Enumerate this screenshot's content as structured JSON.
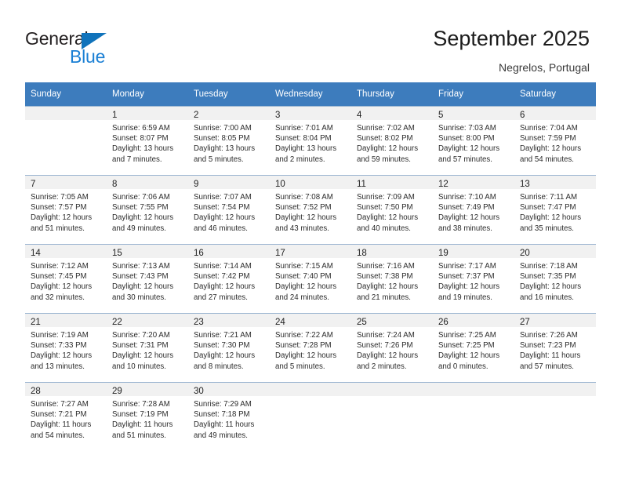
{
  "brand": {
    "name_top": "General",
    "name_bottom": "Blue",
    "triangle_color": "#1073bb",
    "blue_text_color": "#1a7fd4"
  },
  "header": {
    "title": "September 2025",
    "location": "Negrelos, Portugal"
  },
  "theme": {
    "header_blue": "#3d7cbd",
    "day_band_gray": "#f1f1f1",
    "row_line": "#9ab4d0"
  },
  "calendar": {
    "weekday_headers": [
      "Sunday",
      "Monday",
      "Tuesday",
      "Wednesday",
      "Thursday",
      "Friday",
      "Saturday"
    ],
    "weeks": [
      [
        {
          "day": "",
          "sunrise": "",
          "sunset": "",
          "daylight_line1": "",
          "daylight_line2": ""
        },
        {
          "day": "1",
          "sunrise": "Sunrise: 6:59 AM",
          "sunset": "Sunset: 8:07 PM",
          "daylight_line1": "Daylight: 13 hours",
          "daylight_line2": "and 7 minutes."
        },
        {
          "day": "2",
          "sunrise": "Sunrise: 7:00 AM",
          "sunset": "Sunset: 8:05 PM",
          "daylight_line1": "Daylight: 13 hours",
          "daylight_line2": "and 5 minutes."
        },
        {
          "day": "3",
          "sunrise": "Sunrise: 7:01 AM",
          "sunset": "Sunset: 8:04 PM",
          "daylight_line1": "Daylight: 13 hours",
          "daylight_line2": "and 2 minutes."
        },
        {
          "day": "4",
          "sunrise": "Sunrise: 7:02 AM",
          "sunset": "Sunset: 8:02 PM",
          "daylight_line1": "Daylight: 12 hours",
          "daylight_line2": "and 59 minutes."
        },
        {
          "day": "5",
          "sunrise": "Sunrise: 7:03 AM",
          "sunset": "Sunset: 8:00 PM",
          "daylight_line1": "Daylight: 12 hours",
          "daylight_line2": "and 57 minutes."
        },
        {
          "day": "6",
          "sunrise": "Sunrise: 7:04 AM",
          "sunset": "Sunset: 7:59 PM",
          "daylight_line1": "Daylight: 12 hours",
          "daylight_line2": "and 54 minutes."
        }
      ],
      [
        {
          "day": "7",
          "sunrise": "Sunrise: 7:05 AM",
          "sunset": "Sunset: 7:57 PM",
          "daylight_line1": "Daylight: 12 hours",
          "daylight_line2": "and 51 minutes."
        },
        {
          "day": "8",
          "sunrise": "Sunrise: 7:06 AM",
          "sunset": "Sunset: 7:55 PM",
          "daylight_line1": "Daylight: 12 hours",
          "daylight_line2": "and 49 minutes."
        },
        {
          "day": "9",
          "sunrise": "Sunrise: 7:07 AM",
          "sunset": "Sunset: 7:54 PM",
          "daylight_line1": "Daylight: 12 hours",
          "daylight_line2": "and 46 minutes."
        },
        {
          "day": "10",
          "sunrise": "Sunrise: 7:08 AM",
          "sunset": "Sunset: 7:52 PM",
          "daylight_line1": "Daylight: 12 hours",
          "daylight_line2": "and 43 minutes."
        },
        {
          "day": "11",
          "sunrise": "Sunrise: 7:09 AM",
          "sunset": "Sunset: 7:50 PM",
          "daylight_line1": "Daylight: 12 hours",
          "daylight_line2": "and 40 minutes."
        },
        {
          "day": "12",
          "sunrise": "Sunrise: 7:10 AM",
          "sunset": "Sunset: 7:49 PM",
          "daylight_line1": "Daylight: 12 hours",
          "daylight_line2": "and 38 minutes."
        },
        {
          "day": "13",
          "sunrise": "Sunrise: 7:11 AM",
          "sunset": "Sunset: 7:47 PM",
          "daylight_line1": "Daylight: 12 hours",
          "daylight_line2": "and 35 minutes."
        }
      ],
      [
        {
          "day": "14",
          "sunrise": "Sunrise: 7:12 AM",
          "sunset": "Sunset: 7:45 PM",
          "daylight_line1": "Daylight: 12 hours",
          "daylight_line2": "and 32 minutes."
        },
        {
          "day": "15",
          "sunrise": "Sunrise: 7:13 AM",
          "sunset": "Sunset: 7:43 PM",
          "daylight_line1": "Daylight: 12 hours",
          "daylight_line2": "and 30 minutes."
        },
        {
          "day": "16",
          "sunrise": "Sunrise: 7:14 AM",
          "sunset": "Sunset: 7:42 PM",
          "daylight_line1": "Daylight: 12 hours",
          "daylight_line2": "and 27 minutes."
        },
        {
          "day": "17",
          "sunrise": "Sunrise: 7:15 AM",
          "sunset": "Sunset: 7:40 PM",
          "daylight_line1": "Daylight: 12 hours",
          "daylight_line2": "and 24 minutes."
        },
        {
          "day": "18",
          "sunrise": "Sunrise: 7:16 AM",
          "sunset": "Sunset: 7:38 PM",
          "daylight_line1": "Daylight: 12 hours",
          "daylight_line2": "and 21 minutes."
        },
        {
          "day": "19",
          "sunrise": "Sunrise: 7:17 AM",
          "sunset": "Sunset: 7:37 PM",
          "daylight_line1": "Daylight: 12 hours",
          "daylight_line2": "and 19 minutes."
        },
        {
          "day": "20",
          "sunrise": "Sunrise: 7:18 AM",
          "sunset": "Sunset: 7:35 PM",
          "daylight_line1": "Daylight: 12 hours",
          "daylight_line2": "and 16 minutes."
        }
      ],
      [
        {
          "day": "21",
          "sunrise": "Sunrise: 7:19 AM",
          "sunset": "Sunset: 7:33 PM",
          "daylight_line1": "Daylight: 12 hours",
          "daylight_line2": "and 13 minutes."
        },
        {
          "day": "22",
          "sunrise": "Sunrise: 7:20 AM",
          "sunset": "Sunset: 7:31 PM",
          "daylight_line1": "Daylight: 12 hours",
          "daylight_line2": "and 10 minutes."
        },
        {
          "day": "23",
          "sunrise": "Sunrise: 7:21 AM",
          "sunset": "Sunset: 7:30 PM",
          "daylight_line1": "Daylight: 12 hours",
          "daylight_line2": "and 8 minutes."
        },
        {
          "day": "24",
          "sunrise": "Sunrise: 7:22 AM",
          "sunset": "Sunset: 7:28 PM",
          "daylight_line1": "Daylight: 12 hours",
          "daylight_line2": "and 5 minutes."
        },
        {
          "day": "25",
          "sunrise": "Sunrise: 7:24 AM",
          "sunset": "Sunset: 7:26 PM",
          "daylight_line1": "Daylight: 12 hours",
          "daylight_line2": "and 2 minutes."
        },
        {
          "day": "26",
          "sunrise": "Sunrise: 7:25 AM",
          "sunset": "Sunset: 7:25 PM",
          "daylight_line1": "Daylight: 12 hours",
          "daylight_line2": "and 0 minutes."
        },
        {
          "day": "27",
          "sunrise": "Sunrise: 7:26 AM",
          "sunset": "Sunset: 7:23 PM",
          "daylight_line1": "Daylight: 11 hours",
          "daylight_line2": "and 57 minutes."
        }
      ],
      [
        {
          "day": "28",
          "sunrise": "Sunrise: 7:27 AM",
          "sunset": "Sunset: 7:21 PM",
          "daylight_line1": "Daylight: 11 hours",
          "daylight_line2": "and 54 minutes."
        },
        {
          "day": "29",
          "sunrise": "Sunrise: 7:28 AM",
          "sunset": "Sunset: 7:19 PM",
          "daylight_line1": "Daylight: 11 hours",
          "daylight_line2": "and 51 minutes."
        },
        {
          "day": "30",
          "sunrise": "Sunrise: 7:29 AM",
          "sunset": "Sunset: 7:18 PM",
          "daylight_line1": "Daylight: 11 hours",
          "daylight_line2": "and 49 minutes."
        },
        {
          "day": "",
          "sunrise": "",
          "sunset": "",
          "daylight_line1": "",
          "daylight_line2": ""
        },
        {
          "day": "",
          "sunrise": "",
          "sunset": "",
          "daylight_line1": "",
          "daylight_line2": ""
        },
        {
          "day": "",
          "sunrise": "",
          "sunset": "",
          "daylight_line1": "",
          "daylight_line2": ""
        },
        {
          "day": "",
          "sunrise": "",
          "sunset": "",
          "daylight_line1": "",
          "daylight_line2": ""
        }
      ]
    ]
  }
}
